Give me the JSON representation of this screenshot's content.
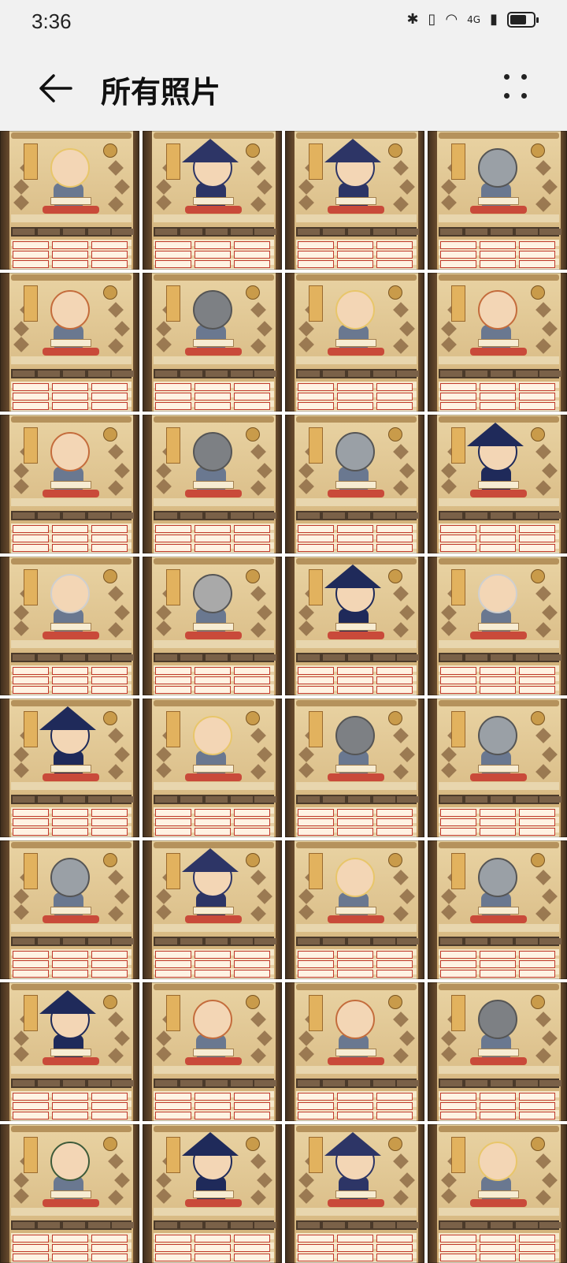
{
  "status": {
    "time": "3:36",
    "network": "4G",
    "battery_level": 0.7
  },
  "app_bar": {
    "title": "所有照片"
  },
  "grid": {
    "columns": 4,
    "rows": 8,
    "photos": [
      {
        "theme": "blond"
      },
      {
        "theme": "wizard"
      },
      {
        "theme": "wizard"
      },
      {
        "theme": "knight"
      },
      {
        "theme": "archer"
      },
      {
        "theme": "helmet"
      },
      {
        "theme": "blond"
      },
      {
        "theme": "archer"
      },
      {
        "theme": "archer"
      },
      {
        "theme": "helmet"
      },
      {
        "theme": "knight"
      },
      {
        "theme": "witch"
      },
      {
        "theme": "elder"
      },
      {
        "theme": "viking"
      },
      {
        "theme": "witch"
      },
      {
        "theme": "elder"
      },
      {
        "theme": "witch"
      },
      {
        "theme": "blond"
      },
      {
        "theme": "helmet"
      },
      {
        "theme": "knight"
      },
      {
        "theme": "knight"
      },
      {
        "theme": "wizard"
      },
      {
        "theme": "blond"
      },
      {
        "theme": "knight"
      },
      {
        "theme": "witch"
      },
      {
        "theme": "archer"
      },
      {
        "theme": "archer"
      },
      {
        "theme": "helmet"
      },
      {
        "theme": "hat"
      },
      {
        "theme": "witch"
      },
      {
        "theme": "wizard"
      },
      {
        "theme": "blond"
      }
    ]
  },
  "colors": {
    "wizard": "#2d3566",
    "witch": "#1f2a5a",
    "knight": "#9aa0a6",
    "helmet": "#7d8084",
    "blond": "#e8c66a",
    "archer": "#c46c3c",
    "elder": "#cfcfcf",
    "viking": "#a9a9a9",
    "hat": "#3e5b3a"
  }
}
